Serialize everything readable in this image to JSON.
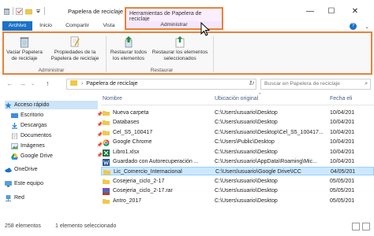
{
  "window": {
    "title": "Papelera de reciclaje",
    "context_tab": "Herramientas de Papelera de reciclaje",
    "context_ribbon": "Administrar",
    "accent_color": "#1a73c7",
    "highlight_color": "#e8823a"
  },
  "tabs": [
    "Archivo",
    "Inicio",
    "Compartir",
    "Vista"
  ],
  "ribbon": {
    "buttons": [
      {
        "label": "Vaciar Papelera de reciclaje",
        "icon": "empty-recycle-bin-icon"
      },
      {
        "label": "Propiedades de la Papelera de reciclaje",
        "icon": "properties-icon"
      },
      {
        "label": "Restaurar todos los elementos",
        "icon": "restore-all-icon"
      },
      {
        "label": "Restaurar los elementos seleccionados",
        "icon": "restore-selected-icon"
      }
    ],
    "groups": [
      "Administrar",
      "Restaurar"
    ]
  },
  "address": {
    "path": "Papelera de reciclaje",
    "search_placeholder": "Buscar en Papelera de reciclaje"
  },
  "nav": [
    {
      "label": "Acceso rápido",
      "icon": "star-icon",
      "pinned": false,
      "selected": true
    },
    {
      "label": "Escritorio",
      "icon": "desktop-icon",
      "pinned": true
    },
    {
      "label": "Descargas",
      "icon": "download-icon",
      "pinned": true
    },
    {
      "label": "Documentos",
      "icon": "documents-icon",
      "pinned": true
    },
    {
      "label": "Imágenes",
      "icon": "pictures-icon",
      "pinned": true
    },
    {
      "label": "Google Drive",
      "icon": "google-drive-icon",
      "pinned": true
    },
    {
      "label": "OneDrive",
      "icon": "onedrive-icon",
      "pinned": false
    },
    {
      "label": "Este equipo",
      "icon": "computer-icon",
      "pinned": false
    },
    {
      "label": "Red",
      "icon": "network-icon",
      "pinned": false
    }
  ],
  "columns": {
    "name": "Nombre",
    "location": "Ubicación original",
    "date": "Fecha eli"
  },
  "files": [
    {
      "name": "Nueva carpeta",
      "location": "C:\\Users\\usuario\\Desktop",
      "date": "10/04/201",
      "icon": "folder"
    },
    {
      "name": "Databases",
      "location": "C:\\Users\\usuario\\Desktop",
      "date": "10/04/201",
      "icon": "folder"
    },
    {
      "name": "Cel_S5_100417",
      "location": "C:\\Users\\usuario\\Desktop\\Cel_S5_100417...",
      "date": "10/04/201",
      "icon": "folder"
    },
    {
      "name": "Google Chrome",
      "location": "C:\\Users\\Public\\Desktop",
      "date": "10/04/201",
      "icon": "chrome"
    },
    {
      "name": "Libro1.xlsx",
      "location": "C:\\Users\\usuario\\Desktop",
      "date": "10/04/201",
      "icon": "excel"
    },
    {
      "name": "Guardado con Autorecuperación ...",
      "location": "C:\\Users\\usuario\\AppData\\Roaming\\Mic...",
      "date": "10/04/201",
      "icon": "word"
    },
    {
      "name": "Lic_Comercio_Internacional",
      "location": "C:\\Users\\usuario\\Google Drive\\ICC",
      "date": "04/05/201",
      "icon": "folder",
      "selected": true
    },
    {
      "name": "Cosejeria_ciclo_2-17",
      "location": "C:\\Users\\usuario\\Desktop",
      "date": "05/05/201",
      "icon": "folder"
    },
    {
      "name": "Cosejeria_ciclo_2-17.rar",
      "location": "C:\\Users\\usuario\\Desktop",
      "date": "05/05/201",
      "icon": "rar"
    },
    {
      "name": "Antro_2017",
      "location": "C:\\Users\\usuario\\Desktop",
      "date": "05/05/201",
      "icon": "folder"
    }
  ],
  "status": {
    "count": "258 elementos",
    "selection": "1 elemento seleccionado"
  }
}
